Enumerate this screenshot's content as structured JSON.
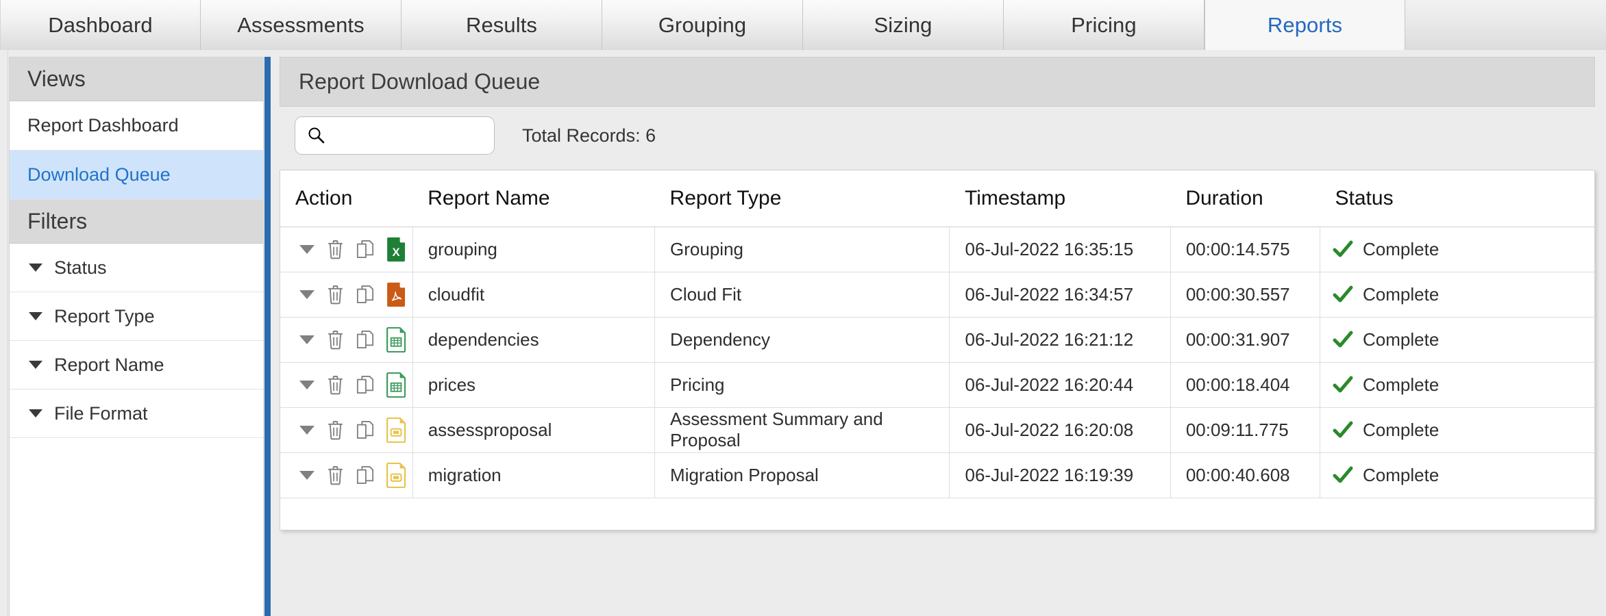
{
  "tabs": [
    {
      "label": "Dashboard",
      "active": false
    },
    {
      "label": "Assessments",
      "active": false
    },
    {
      "label": "Results",
      "active": false
    },
    {
      "label": "Grouping",
      "active": false
    },
    {
      "label": "Sizing",
      "active": false
    },
    {
      "label": "Pricing",
      "active": false
    },
    {
      "label": "Reports",
      "active": true
    }
  ],
  "sidebar": {
    "views_header": "Views",
    "views": [
      {
        "label": "Report Dashboard",
        "selected": false
      },
      {
        "label": "Download Queue",
        "selected": true
      }
    ],
    "filters_header": "Filters",
    "filters": [
      {
        "label": "Status"
      },
      {
        "label": "Report Type"
      },
      {
        "label": "Report Name"
      },
      {
        "label": "File Format"
      }
    ]
  },
  "panel": {
    "title": "Report Download Queue",
    "search": {
      "value": "",
      "placeholder": ""
    },
    "total_records_label": "Total Records: 6",
    "total_records": 6
  },
  "table": {
    "columns": [
      "Action",
      "Report Name",
      "Report Type",
      "Timestamp",
      "Duration",
      "Status"
    ],
    "rows": [
      {
        "file_format": "excel",
        "report_name": "grouping",
        "report_type": "Grouping",
        "timestamp": "06-Jul-2022 16:35:15",
        "duration": "00:00:14.575",
        "status": "Complete"
      },
      {
        "file_format": "pdf",
        "report_name": "cloudfit",
        "report_type": "Cloud Fit",
        "timestamp": "06-Jul-2022 16:34:57",
        "duration": "00:00:30.557",
        "status": "Complete"
      },
      {
        "file_format": "spreadsheet",
        "report_name": "dependencies",
        "report_type": "Dependency",
        "timestamp": "06-Jul-2022 16:21:12",
        "duration": "00:00:31.907",
        "status": "Complete"
      },
      {
        "file_format": "spreadsheet",
        "report_name": "prices",
        "report_type": "Pricing",
        "timestamp": "06-Jul-2022 16:20:44",
        "duration": "00:00:18.404",
        "status": "Complete"
      },
      {
        "file_format": "presentation",
        "report_name": "assessproposal",
        "report_type": "Assessment Summary and Proposal",
        "timestamp": "06-Jul-2022 16:20:08",
        "duration": "00:09:11.775",
        "status": "Complete"
      },
      {
        "file_format": "presentation",
        "report_name": "migration",
        "report_type": "Migration Proposal",
        "timestamp": "06-Jul-2022 16:19:39",
        "duration": "00:00:40.608",
        "status": "Complete"
      }
    ]
  },
  "icons": {
    "search": "search-icon",
    "expand": "chevron-down-icon",
    "delete": "trash-icon",
    "copy": "copy-icon",
    "status_ok": "check-icon"
  },
  "colors": {
    "accent_blue": "#2272c9",
    "separator_blue": "#2b6cb0",
    "selected_row": "#cfe4fb",
    "excel_green": "#1e8036",
    "pdf_orange": "#ca5a15",
    "spreadsheet_green": "#3c9c5e",
    "presentation_yellow": "#e8c44d",
    "status_green": "#2a8a2a",
    "icon_gray": "#808080"
  }
}
